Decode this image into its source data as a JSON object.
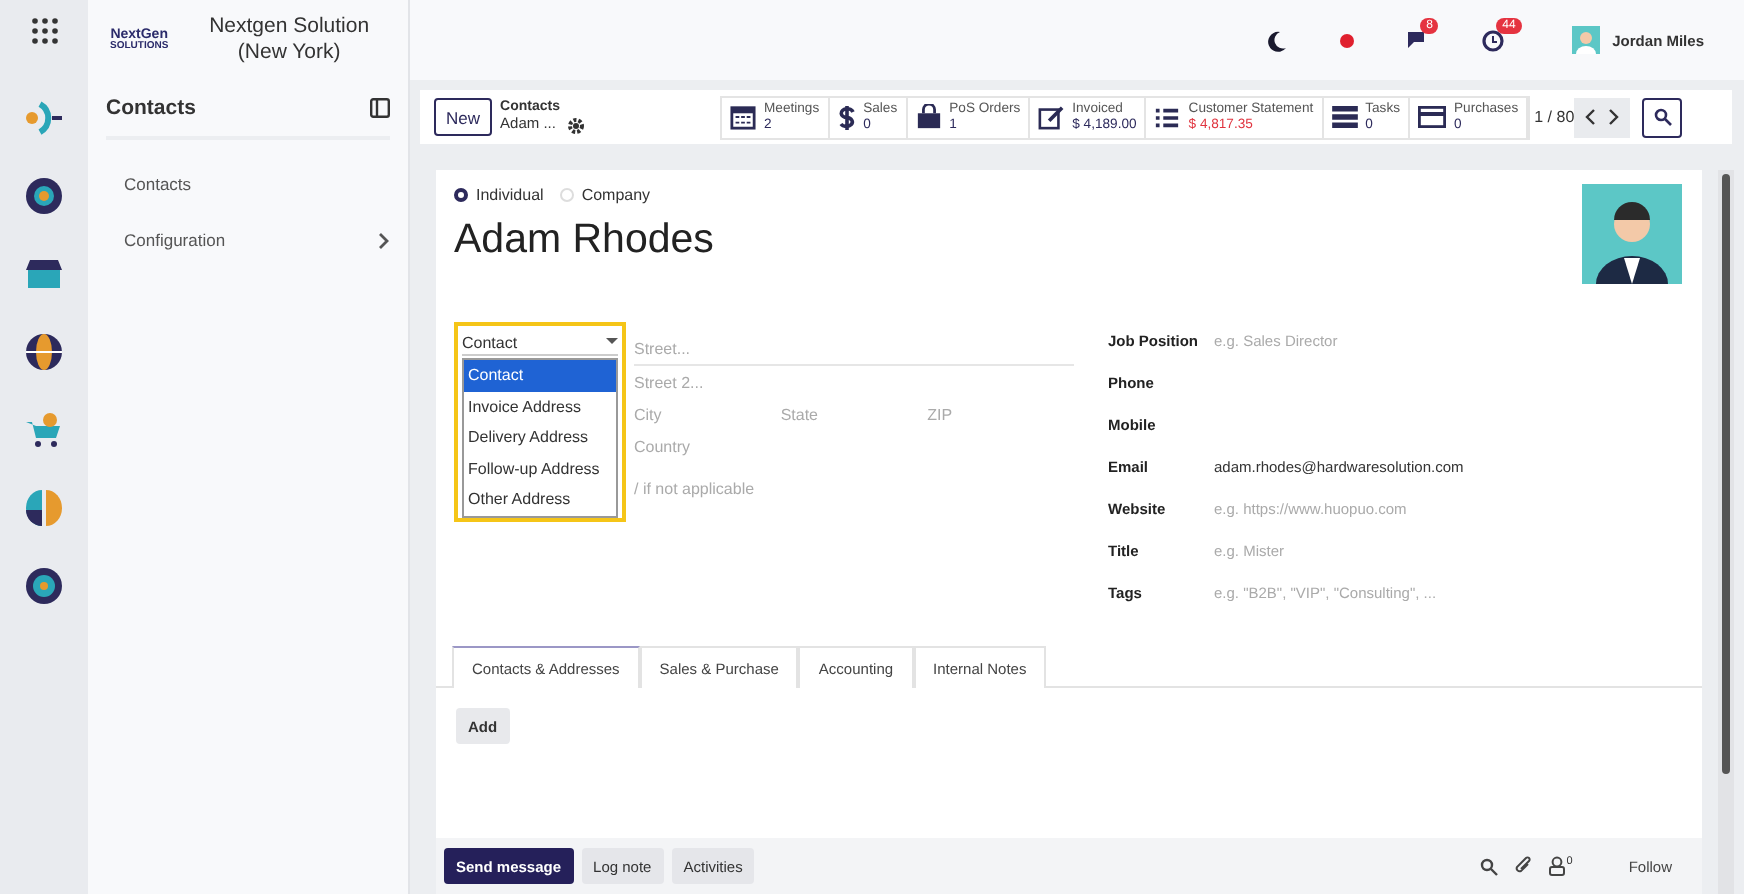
{
  "company": {
    "logo": "NextGen",
    "logo_sub": "SOLUTIONS",
    "name": "Nextgen Solution (New York)"
  },
  "sidebar": {
    "title": "Contacts",
    "items": [
      {
        "label": "Contacts",
        "has_submenu": false
      },
      {
        "label": "Configuration",
        "has_submenu": true
      }
    ]
  },
  "topbar": {
    "chat_badge": "8",
    "activity_badge": "44",
    "user": "Jordan Miles"
  },
  "control_panel": {
    "new_button": "New",
    "breadcrumb": "Contacts",
    "record": "Adam ...",
    "pager": "1 / 80",
    "smart_buttons": [
      {
        "kind": "calendar",
        "label": "Meetings",
        "value": "2",
        "negative": false
      },
      {
        "kind": "dollar",
        "label": "Sales",
        "value": "0",
        "negative": false
      },
      {
        "kind": "bag",
        "label": "PoS Orders",
        "value": "1",
        "negative": false
      },
      {
        "kind": "edit",
        "label": "Invoiced",
        "value": "$ 4,189.00",
        "negative": false
      },
      {
        "kind": "list",
        "label": "Customer Statement",
        "value": "$ 4,817.35",
        "negative": true
      },
      {
        "kind": "tasks",
        "label": "Tasks",
        "value": "0",
        "negative": false
      },
      {
        "kind": "card",
        "label": "Purchases",
        "value": "0",
        "negative": false
      }
    ]
  },
  "form": {
    "type_options": [
      {
        "label": "Individual",
        "selected": true
      },
      {
        "label": "Company",
        "selected": false
      }
    ],
    "name": "Adam Rhodes",
    "address_type": {
      "value": "Contact",
      "options": [
        {
          "label": "Contact",
          "selected": true
        },
        {
          "label": "Invoice Address",
          "selected": false
        },
        {
          "label": "Delivery Address",
          "selected": false
        },
        {
          "label": "Follow-up Address",
          "selected": false
        },
        {
          "label": "Other Address",
          "selected": false
        }
      ]
    },
    "address": {
      "street": "Street...",
      "street2": "Street 2...",
      "city": "City",
      "state": "State",
      "zip": "ZIP",
      "country": "Country",
      "vat_hint": "/ if not applicable"
    },
    "fields": [
      {
        "label": "Job Position",
        "placeholder": "e.g. Sales Director"
      },
      {
        "label": "Phone"
      },
      {
        "label": "Mobile"
      },
      {
        "label": "Email",
        "value": "adam.rhodes@hardwaresolution.com"
      },
      {
        "label": "Website",
        "placeholder": "e.g. https://www.huopuo.com"
      },
      {
        "label": "Title",
        "placeholder": "e.g. Mister"
      },
      {
        "label": "Tags",
        "placeholder": "e.g. \"B2B\", \"VIP\", \"Consulting\", ..."
      }
    ]
  },
  "tabs": [
    {
      "label": "Contacts & Addresses",
      "selected": true
    },
    {
      "label": "Sales & Purchase",
      "selected": false
    },
    {
      "label": "Accounting",
      "selected": false
    },
    {
      "label": "Internal Notes",
      "selected": false
    }
  ],
  "add_button": "Add",
  "chatter": {
    "buttons": [
      {
        "label": "Send message",
        "primary": true
      },
      {
        "label": "Log note",
        "primary": false
      },
      {
        "label": "Activities",
        "primary": false
      }
    ],
    "followers": "0",
    "follow": "Follow"
  }
}
